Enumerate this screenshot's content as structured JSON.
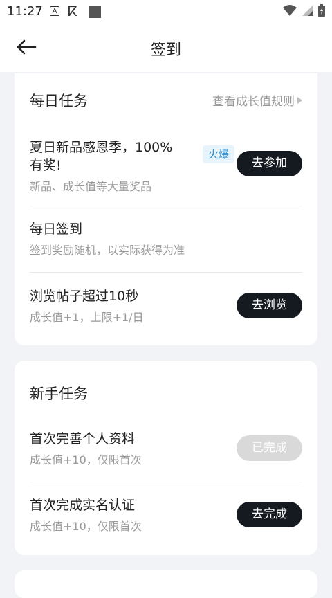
{
  "status_bar": {
    "time": "11:27"
  },
  "header": {
    "title": "签到"
  },
  "daily": {
    "title": "每日任务",
    "rules_link": "查看成长值规则",
    "tasks": [
      {
        "name_line1": "夏日新品感恩季，100%",
        "name_line2": "有奖!",
        "desc": "新品、成长值等大量奖品",
        "badge": "火爆",
        "button": "去参加"
      },
      {
        "name": "每日签到",
        "desc": "签到奖励随机，以实际获得为准"
      },
      {
        "name": "浏览帖子超过10秒",
        "desc": "成长值+1，上限+1/日",
        "button": "去浏览"
      }
    ]
  },
  "newbie": {
    "title": "新手任务",
    "tasks": [
      {
        "name": "首次完善个人资料",
        "desc": "成长值+10，仅限首次",
        "button": "已完成"
      },
      {
        "name": "首次完成实名认证",
        "desc": "成长值+10，仅限首次",
        "button": "去完成"
      }
    ]
  },
  "colors": {
    "button_dark": "#151a20",
    "button_done": "#d9d9d9",
    "badge_text": "#2f8fd0",
    "background": "#f2f3f7"
  }
}
